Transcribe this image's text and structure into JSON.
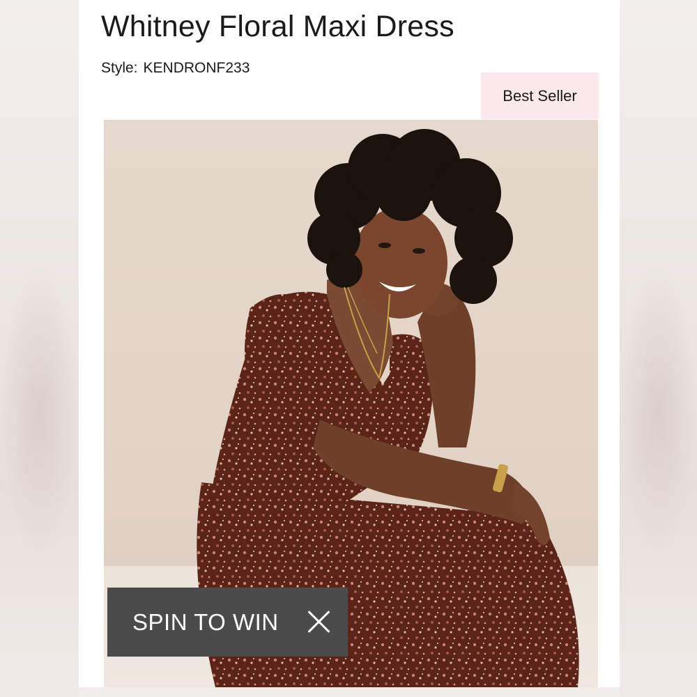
{
  "product": {
    "title": "Whitney Floral Maxi Dress",
    "style_label": "Style:",
    "style_code": "KENDRONF233",
    "badge": "Best Seller"
  },
  "image": {
    "subject": "woman-in-floral-maxi-dress"
  },
  "promo": {
    "label": "SPIN TO WIN",
    "close_icon": "close-icon"
  },
  "colors": {
    "badge_bg": "#fbe8ea",
    "promo_bg": "#4b4b4b",
    "dress": "#5a2418"
  }
}
